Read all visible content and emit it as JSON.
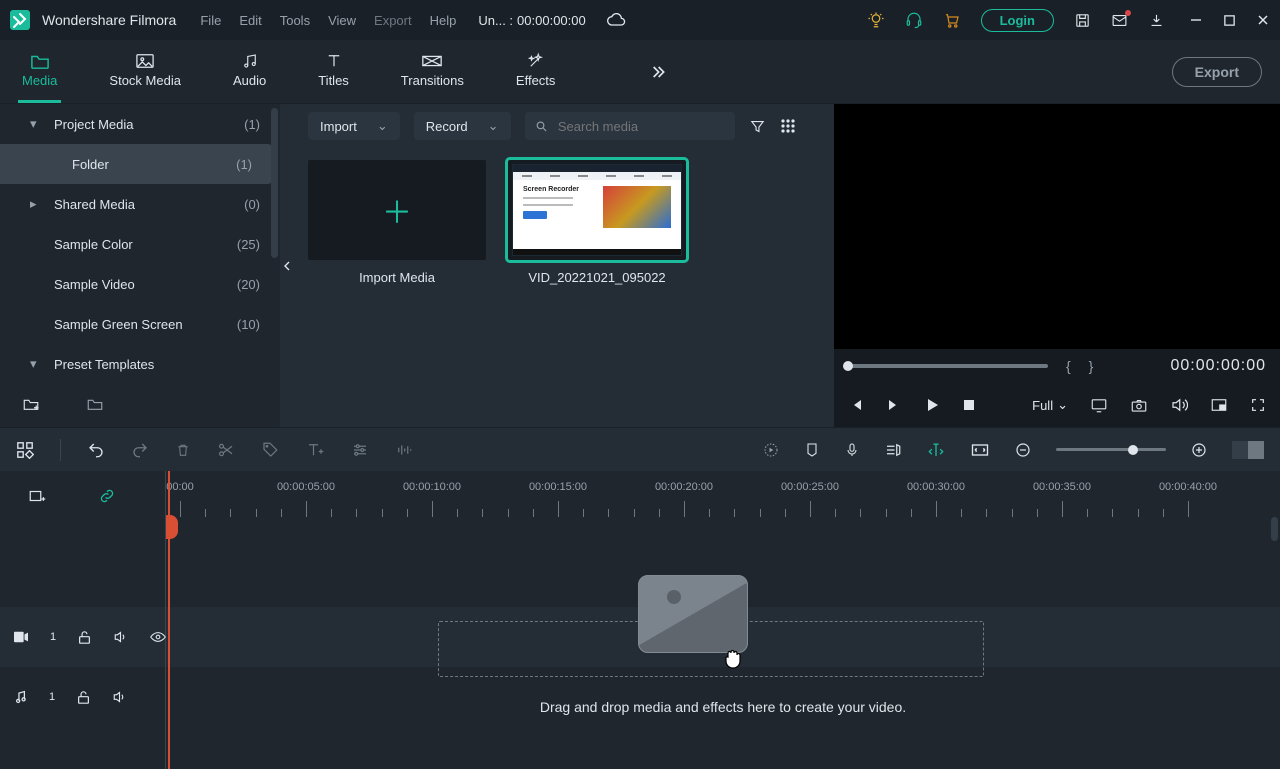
{
  "app_name": "Wondershare Filmora",
  "titlebar": {
    "menus": [
      "File",
      "Edit",
      "Tools",
      "View",
      "Export",
      "Help"
    ],
    "disabled_menus": [
      "Export"
    ],
    "project_label": "Un... :",
    "project_time": "00:00:00:00",
    "login_label": "Login"
  },
  "tabs": {
    "items": [
      "Media",
      "Stock Media",
      "Audio",
      "Titles",
      "Transitions",
      "Effects"
    ],
    "active": "Media",
    "export_label": "Export"
  },
  "tree": {
    "items": [
      {
        "label": "Project Media",
        "count": "(1)",
        "expanded": true,
        "indent": 0
      },
      {
        "label": "Folder",
        "count": "(1)",
        "expanded": false,
        "indent": 1,
        "selected": true,
        "nodisclosure": true
      },
      {
        "label": "Shared Media",
        "count": "(0)",
        "expanded": false,
        "indent": 0,
        "right": true
      },
      {
        "label": "Sample Color",
        "count": "(25)",
        "expanded": false,
        "indent": 0,
        "nodisclosure": true
      },
      {
        "label": "Sample Video",
        "count": "(20)",
        "expanded": false,
        "indent": 0,
        "nodisclosure": true
      },
      {
        "label": "Sample Green Screen",
        "count": "(10)",
        "expanded": false,
        "indent": 0,
        "nodisclosure": true
      },
      {
        "label": "Preset Templates",
        "count": "",
        "expanded": true,
        "indent": 0
      }
    ]
  },
  "browser": {
    "import_dd": "Import",
    "record_dd": "Record",
    "search_placeholder": "Search media",
    "import_card_label": "Import Media",
    "clip_label": "VID_20221021_095022",
    "clip_title": "Screen Recorder"
  },
  "preview": {
    "timecode": "00:00:00:00",
    "quality": "Full"
  },
  "ruler": {
    "labels": [
      "00:00",
      "00:00:05:00",
      "00:00:10:00",
      "00:00:15:00",
      "00:00:20:00",
      "00:00:25:00",
      "00:00:30:00",
      "00:00:35:00",
      "00:00:40:00"
    ]
  },
  "timeline": {
    "video_track_index": "1",
    "audio_track_index": "1",
    "drop_hint": "Drag and drop media and effects here to create your video."
  }
}
